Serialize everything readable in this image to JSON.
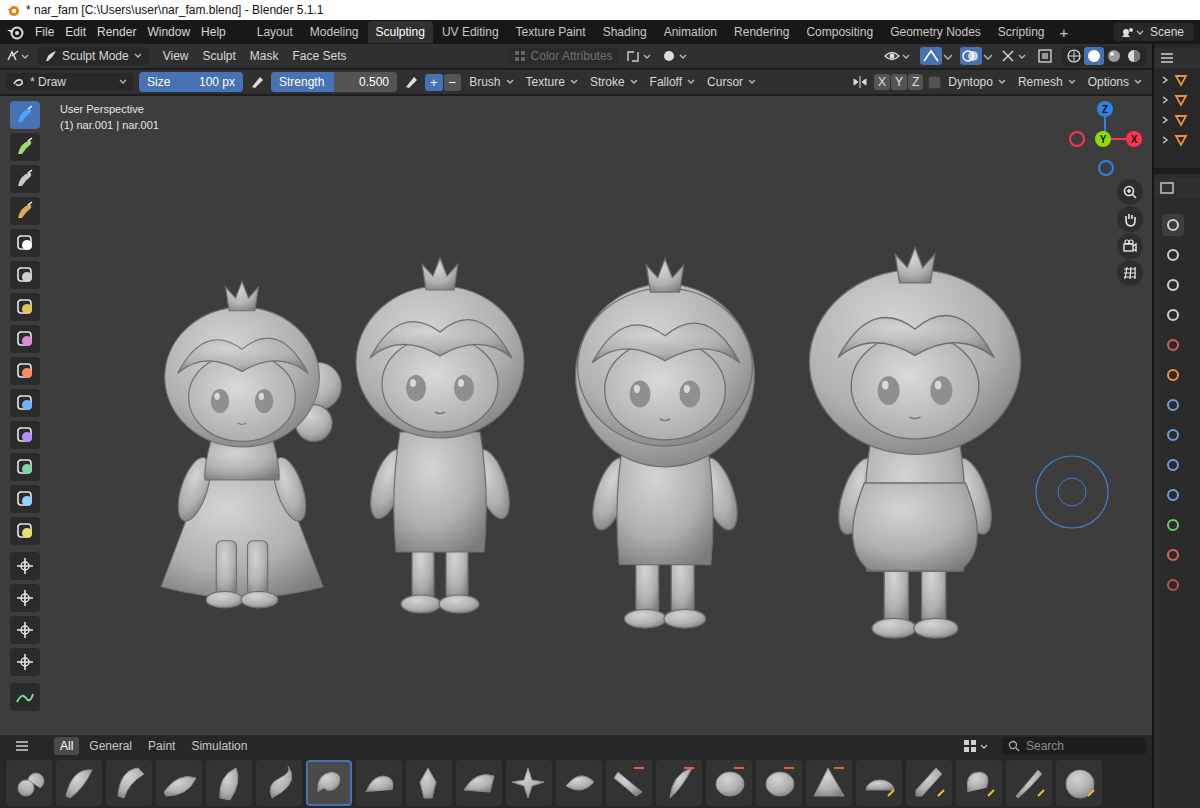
{
  "window": {
    "title": "* nar_fam [C:\\Users\\user\\nar_fam.blend] - Blender 5.1.1"
  },
  "menu": [
    "File",
    "Edit",
    "Render",
    "Window",
    "Help"
  ],
  "workspaces": [
    {
      "label": "Layout",
      "selected": false
    },
    {
      "label": "Modeling",
      "selected": false
    },
    {
      "label": "Sculpting",
      "selected": true
    },
    {
      "label": "UV Editing",
      "selected": false
    },
    {
      "label": "Texture Paint",
      "selected": false
    },
    {
      "label": "Shading",
      "selected": false
    },
    {
      "label": "Animation",
      "selected": false
    },
    {
      "label": "Rendering",
      "selected": false
    },
    {
      "label": "Compositing",
      "selected": false
    },
    {
      "label": "Geometry Nodes",
      "selected": false
    },
    {
      "label": "Scripting",
      "selected": false
    }
  ],
  "add_workspace": "+",
  "scene": "Scene",
  "header": {
    "mode": "Sculpt Mode",
    "menus": [
      "View",
      "Sculpt",
      "Mask",
      "Face Sets"
    ],
    "color_attributes": {
      "label": "Color Attributes",
      "disabled": true
    }
  },
  "tool_settings": {
    "brush": "* Draw",
    "size": {
      "label": "Size",
      "value": "100 px"
    },
    "strength": {
      "label": "Strength",
      "value": "0.500",
      "level": 0.5
    },
    "direction": [
      {
        "label": "+",
        "selected": true
      },
      {
        "label": "−",
        "selected": false
      }
    ],
    "menus": [
      "Brush",
      "Texture",
      "Stroke",
      "Falloff",
      "Cursor"
    ],
    "axes": [
      {
        "label": "X",
        "selected": false
      },
      {
        "label": "Y",
        "selected": false
      },
      {
        "label": "Z",
        "selected": false
      }
    ],
    "dyntopo": {
      "label": "Dyntopo",
      "checked": false
    },
    "right_menus": [
      "Remesh",
      "Options"
    ]
  },
  "viewport": {
    "view_name": "User Perspective",
    "object": "(1) nar.001 | nar.001",
    "gizmo": [
      {
        "label": "Z",
        "color": "#2f83e3"
      },
      {
        "label": "Y",
        "color": "#8bdc00"
      },
      {
        "label": "X",
        "color": "#ff3352"
      }
    ],
    "tools": [
      {
        "selected": true
      },
      {
        "selected": false
      },
      {
        "selected": false
      },
      {
        "selected": false
      },
      {
        "selected": false
      },
      {
        "selected": false
      },
      {
        "selected": false
      },
      {
        "selected": false
      },
      {
        "selected": false
      },
      {
        "selected": false
      },
      {
        "selected": false
      },
      {
        "selected": false
      },
      {
        "selected": false
      },
      {
        "selected": false
      },
      {
        "selected": false
      },
      {
        "selected": false
      },
      {
        "selected": false
      },
      {
        "selected": false
      },
      {
        "selected": false
      }
    ]
  },
  "asset_shelf": {
    "tabs": [
      {
        "label": "All",
        "selected": true
      },
      {
        "label": "General",
        "selected": false
      },
      {
        "label": "Paint",
        "selected": false
      },
      {
        "label": "Simulation",
        "selected": false
      }
    ],
    "search": {
      "placeholder": "Search"
    },
    "brushes": [
      {
        "selected": false
      },
      {
        "selected": false
      },
      {
        "selected": false
      },
      {
        "selected": false
      },
      {
        "selected": false
      },
      {
        "selected": false
      },
      {
        "selected": true
      },
      {
        "selected": false
      },
      {
        "selected": false
      },
      {
        "selected": false
      },
      {
        "selected": false
      },
      {
        "selected": false
      },
      {
        "selected": false
      },
      {
        "selected": false
      },
      {
        "selected": false
      },
      {
        "selected": false
      },
      {
        "selected": false
      },
      {
        "selected": false
      },
      {
        "selected": false
      },
      {
        "selected": false
      },
      {
        "selected": false
      },
      {
        "selected": false
      }
    ]
  }
}
